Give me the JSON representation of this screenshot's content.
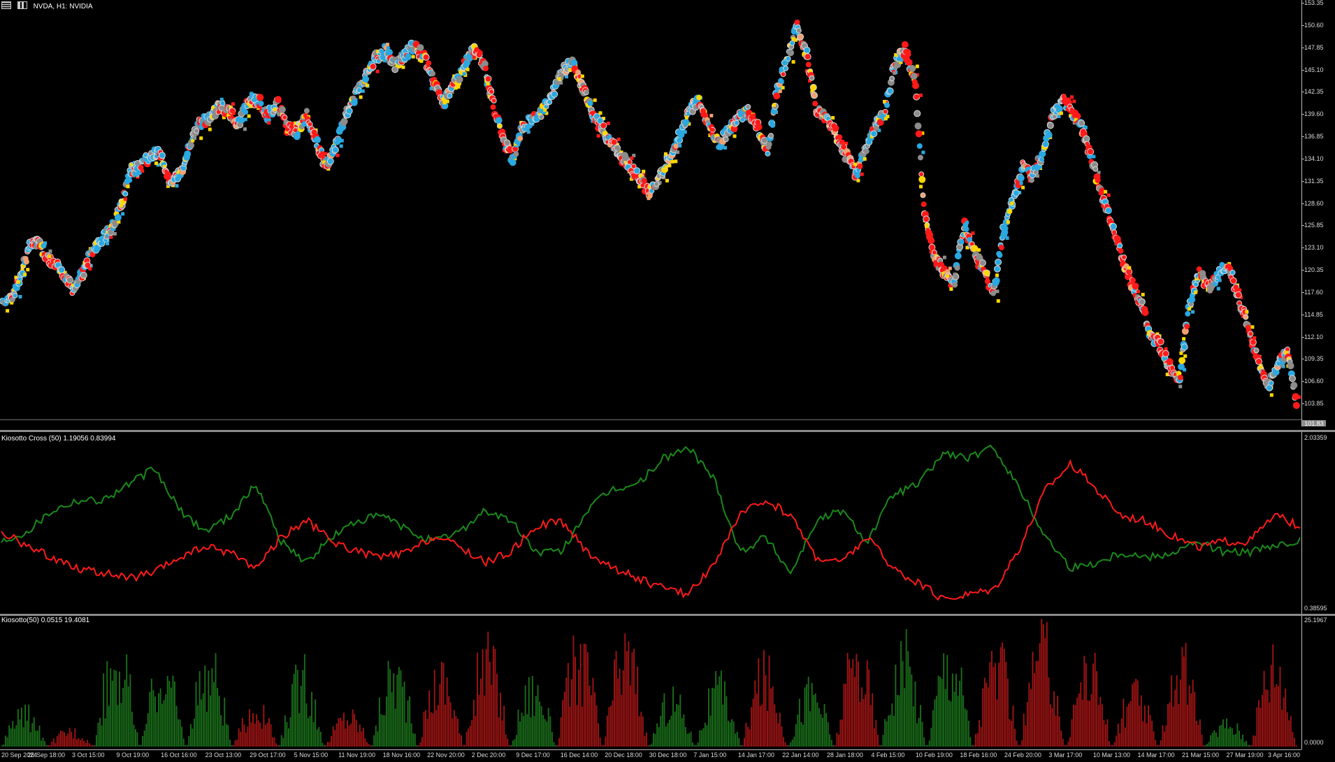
{
  "header": {
    "symbol_title": "NVDA, H1:  NVIDIA",
    "cross_title": "Kiosotto Cross (50) 1.19056 0.83994",
    "vol_title": "Kiosotto(50) 0.0515 19.4081"
  },
  "icons": [
    "grid-icon",
    "candle-icon"
  ],
  "current_price": "101.83",
  "price_axis": [
    "153.35",
    "150.60",
    "147.85",
    "145.10",
    "142.35",
    "139.60",
    "136.85",
    "134.10",
    "131.35",
    "128.60",
    "125.85",
    "123.10",
    "120.35",
    "117.60",
    "114.85",
    "112.10",
    "109.35",
    "106.60",
    "103.85"
  ],
  "cross_axis": [
    "2.03359",
    "0.38595"
  ],
  "vol_axis": [
    "25.1967",
    "0.0000"
  ],
  "time_axis": [
    "20 Sep 2024",
    "26 Sep 18:00",
    "3 Oct 15:00",
    "9 Oct 19:00",
    "16 Oct 16:00",
    "23 Oct 13:00",
    "29 Oct 17:00",
    "5 Nov 15:00",
    "11 Nov 19:00",
    "18 Nov 16:00",
    "22 Nov 20:00",
    "2 Dec 20:00",
    "9 Dec 17:00",
    "16 Dec 14:00",
    "20 Dec 18:00",
    "30 Dec 18:00",
    "7 Jan 15:00",
    "14 Jan 17:00",
    "22 Jan 14:00",
    "28 Jan 18:00",
    "4 Feb 15:00",
    "10 Feb 19:00",
    "18 Feb 16:00",
    "24 Feb 20:00",
    "3 Mar 17:00",
    "10 Mar 13:00",
    "14 Mar 17:00",
    "21 Mar 15:00",
    "27 Mar 19:00",
    "3 Apr 16:00"
  ],
  "colors": {
    "bull": "#2aa8e0",
    "bear": "#ff1a1a",
    "neutral": "#8c8c8c",
    "signal": "#ffd700",
    "cross_green": "#1a8a1a",
    "cross_red": "#ff1a1a",
    "vol_green": "#1a6e1a",
    "vol_red": "#a01414"
  },
  "chart_data": [
    {
      "type": "scatter",
      "name": "NVDA H1 price",
      "ylim": [
        101.0,
        153.7
      ],
      "x": [
        0,
        1,
        2,
        3,
        4,
        5,
        6,
        7,
        8,
        9,
        10,
        11,
        12,
        13,
        14,
        15,
        16,
        17,
        18,
        19,
        20,
        21,
        22,
        23,
        24,
        25,
        26,
        27,
        28,
        29,
        30,
        31,
        32,
        33,
        34,
        35,
        36,
        37,
        38,
        39,
        40,
        41,
        42,
        43,
        44,
        45,
        46,
        47,
        48,
        49,
        50,
        51,
        52,
        53,
        54,
        55,
        56,
        57,
        58,
        59,
        60,
        61,
        62,
        63,
        64,
        65,
        66,
        67,
        68,
        69,
        70,
        71,
        72,
        73,
        74,
        75,
        76,
        77,
        78,
        79,
        80,
        81,
        82,
        83,
        84,
        85,
        86,
        87,
        88,
        89,
        90,
        91,
        92,
        93,
        94,
        95,
        96,
        97,
        98,
        99,
        100,
        101,
        102,
        103,
        104,
        105,
        106,
        107,
        108,
        109,
        110,
        111,
        112,
        113,
        114,
        115,
        116,
        117,
        118,
        119,
        120
      ],
      "values": [
        116.5,
        117,
        120.5,
        124,
        123,
        121,
        120.5,
        118,
        119.5,
        122.5,
        124,
        125.5,
        128,
        132.5,
        133,
        134.5,
        135,
        131,
        132,
        135.5,
        138.5,
        139,
        140.5,
        140,
        138.5,
        141,
        141.5,
        139.5,
        141,
        138,
        137.5,
        139.5,
        136,
        133,
        136,
        139.5,
        142,
        144.5,
        146.5,
        147.5,
        145.5,
        147,
        148,
        146.5,
        143.5,
        141,
        143,
        145.5,
        147.5,
        146,
        141,
        136.5,
        134,
        138,
        139,
        140,
        142,
        145,
        146,
        143.5,
        140,
        138,
        136,
        134.5,
        133,
        131.5,
        130,
        132,
        134.5,
        137,
        140,
        141.5,
        138,
        136,
        137.5,
        139,
        140,
        138,
        134.5,
        143,
        146.5,
        150.5,
        147,
        140,
        139,
        137,
        134.5,
        132,
        135.5,
        138,
        140,
        146,
        147.5,
        144,
        127,
        122,
        120,
        118.5,
        126,
        122.5,
        120.5,
        117,
        125,
        129,
        133,
        132,
        134.5,
        139,
        141.5,
        140,
        138,
        134,
        130,
        126,
        122.5,
        119,
        116.5,
        112.5,
        111,
        108.5,
        107,
        116,
        120,
        118,
        120,
        121,
        117,
        113.5,
        109,
        106,
        108.5,
        110.5,
        103
      ],
      "marker_colors_cycle": [
        "bull",
        "bull",
        "neutral",
        "bear",
        "bull",
        "neutral",
        "bear",
        "bull",
        "signal",
        "bull"
      ]
    },
    {
      "type": "line",
      "name": "Kiosotto Cross (50)",
      "ylim": [
        0.38595,
        2.03359
      ],
      "series": [
        {
          "name": "green",
          "color": "cross_green",
          "values": [
            1.05,
            1.15,
            1.35,
            1.45,
            1.45,
            1.6,
            1.75,
            1.35,
            1.15,
            1.3,
            1.6,
            1.05,
            0.85,
            1.1,
            1.25,
            1.3,
            1.15,
            1.05,
            1.15,
            1.35,
            1.25,
            0.95,
            0.95,
            1.35,
            1.55,
            1.6,
            1.85,
            1.95,
            1.65,
            0.95,
            1.1,
            0.75,
            1.25,
            1.35,
            1.05,
            1.5,
            1.6,
            1.9,
            1.85,
            1.95,
            1.55,
            1.1,
            0.8,
            0.85,
            0.95,
            0.9,
            0.95,
            1.05,
            0.95,
            0.95,
            1.0,
            1.05
          ]
        },
        {
          "name": "red",
          "color": "cross_red",
          "values": [
            1.15,
            1.0,
            0.9,
            0.8,
            0.75,
            0.7,
            0.75,
            0.9,
            1.0,
            0.95,
            0.8,
            1.1,
            1.25,
            1.05,
            0.95,
            0.9,
            0.95,
            1.1,
            1.0,
            0.85,
            0.95,
            1.2,
            1.25,
            0.95,
            0.8,
            0.7,
            0.6,
            0.55,
            0.85,
            1.3,
            1.45,
            1.3,
            0.9,
            0.85,
            1.1,
            0.8,
            0.65,
            0.5,
            0.55,
            0.6,
            1.0,
            1.55,
            1.8,
            1.55,
            1.3,
            1.25,
            1.1,
            1.0,
            1.05,
            1.05,
            1.3,
            1.2
          ]
        }
      ]
    },
    {
      "type": "bar",
      "name": "Kiosotto (50)",
      "ylim": [
        0,
        25.1967
      ],
      "segments": [
        {
          "color": "vol_green",
          "peak": 8
        },
        {
          "color": "vol_red",
          "peak": 4
        },
        {
          "color": "vol_green",
          "peak": 23
        },
        {
          "color": "vol_green",
          "peak": 18
        },
        {
          "color": "vol_green",
          "peak": 20
        },
        {
          "color": "vol_red",
          "peak": 9
        },
        {
          "color": "vol_green",
          "peak": 17
        },
        {
          "color": "vol_red",
          "peak": 8
        },
        {
          "color": "vol_green",
          "peak": 19
        },
        {
          "color": "vol_red",
          "peak": 18
        },
        {
          "color": "vol_red",
          "peak": 22
        },
        {
          "color": "vol_green",
          "peak": 15
        },
        {
          "color": "vol_red",
          "peak": 23
        },
        {
          "color": "vol_red",
          "peak": 24
        },
        {
          "color": "vol_green",
          "peak": 12
        },
        {
          "color": "vol_green",
          "peak": 14
        },
        {
          "color": "vol_red",
          "peak": 18
        },
        {
          "color": "vol_green",
          "peak": 14
        },
        {
          "color": "vol_red",
          "peak": 22
        },
        {
          "color": "vol_green",
          "peak": 22
        },
        {
          "color": "vol_green",
          "peak": 23
        },
        {
          "color": "vol_red",
          "peak": 21
        },
        {
          "color": "vol_red",
          "peak": 24
        },
        {
          "color": "vol_red",
          "peak": 20
        },
        {
          "color": "vol_red",
          "peak": 13
        },
        {
          "color": "vol_red",
          "peak": 20
        },
        {
          "color": "vol_green",
          "peak": 6
        },
        {
          "color": "vol_red",
          "peak": 22
        }
      ]
    }
  ]
}
